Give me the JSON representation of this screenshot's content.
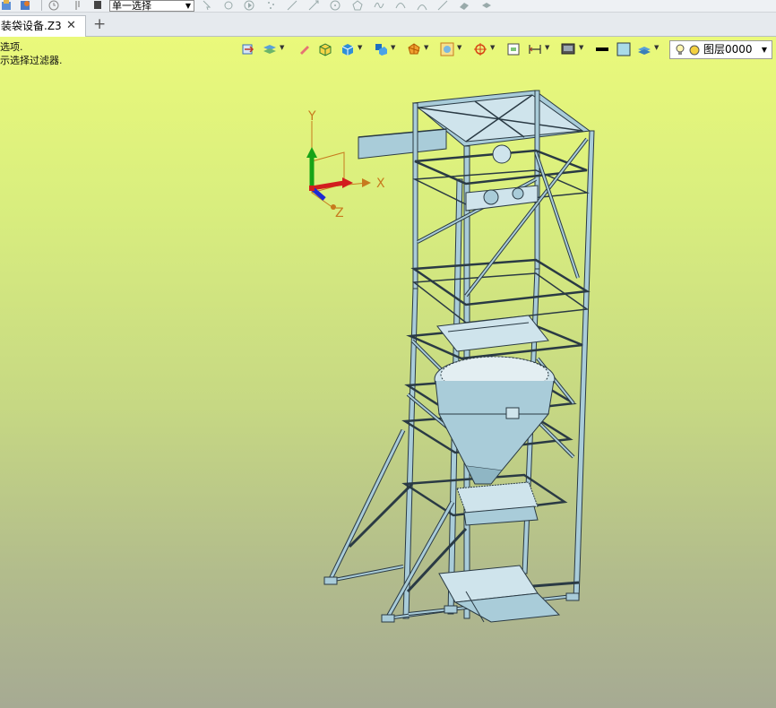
{
  "toolbar": {
    "select_mode": "单一选择"
  },
  "tabs": {
    "active_label": "装袋设备.Z3",
    "close_symbol": "✕",
    "add_symbol": "+"
  },
  "messages": {
    "line1": "选项.",
    "line2": "示选择过滤器."
  },
  "view_toolbar": {
    "layer_label": "图层0000"
  },
  "triad": {
    "x_label": "X",
    "y_label": "Y",
    "z_label": "Z"
  },
  "colors": {
    "model_fill": "#a9ccd9",
    "model_stroke": "#2a3a44",
    "axis_orange": "#c77a1e"
  }
}
